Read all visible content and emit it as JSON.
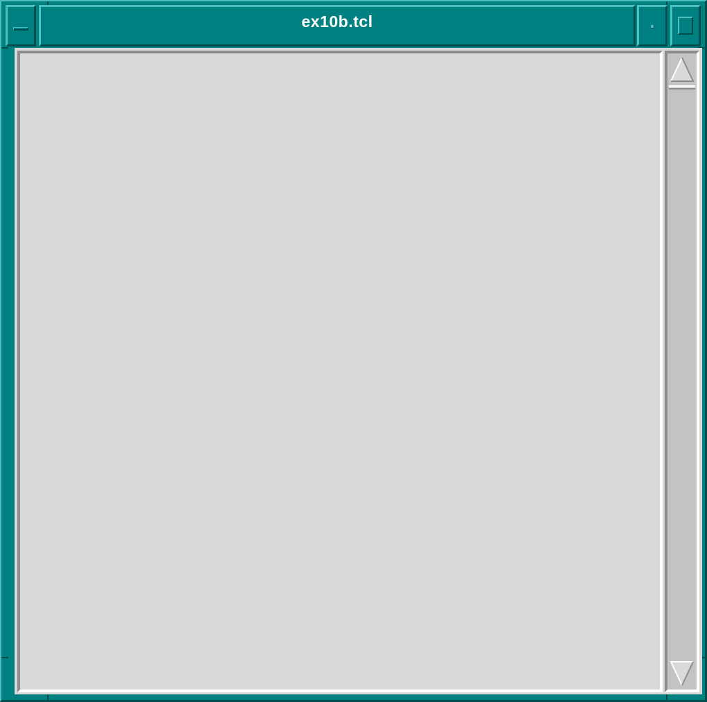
{
  "window": {
    "title": "ex10b.tcl",
    "frame_color": "#008080",
    "client_color": "#d9d9d9"
  },
  "icons": {
    "window_menu": "window-menu-icon",
    "minimize": "minimize-icon",
    "maximize": "maximize-icon",
    "scroll_up": "arrow-up-icon",
    "scroll_down": "arrow-down-icon"
  }
}
